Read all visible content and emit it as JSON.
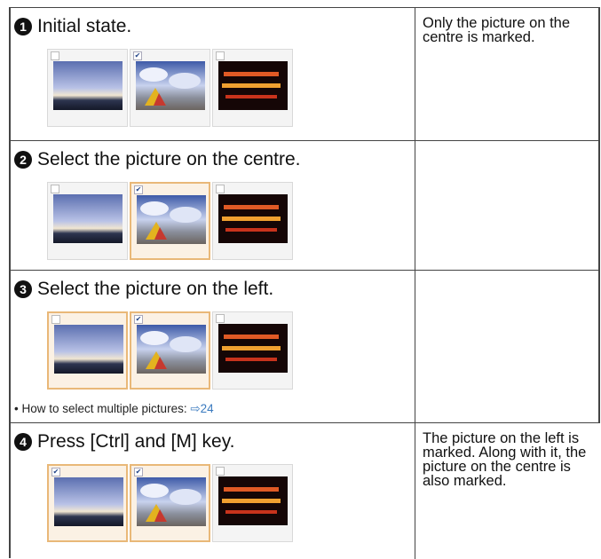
{
  "rows": [
    {
      "num": "1",
      "step": "Initial state.",
      "note": "Only the picture on the centre is marked.",
      "thumbs": [
        {
          "image": "sunset-sky",
          "checked": false,
          "selected": false
        },
        {
          "image": "clouds-tent",
          "checked": true,
          "selected": false
        },
        {
          "image": "night-lights",
          "checked": false,
          "selected": false
        }
      ]
    },
    {
      "num": "2",
      "step": "Select the picture on the centre.",
      "note": "",
      "thumbs": [
        {
          "image": "sunset-sky",
          "checked": false,
          "selected": false
        },
        {
          "image": "clouds-tent",
          "checked": true,
          "selected": true
        },
        {
          "image": "night-lights",
          "checked": false,
          "selected": false
        }
      ]
    },
    {
      "num": "3",
      "step": "Select the picture on the left.",
      "note": "",
      "tip_text": "How to select multiple pictures: ",
      "tip_link": "⇨24",
      "thumbs": [
        {
          "image": "sunset-sky",
          "checked": false,
          "selected": true
        },
        {
          "image": "clouds-tent",
          "checked": true,
          "selected": true
        },
        {
          "image": "night-lights",
          "checked": false,
          "selected": false
        }
      ]
    },
    {
      "num": "4",
      "step": "Press [Ctrl] and [M] key.",
      "note": "The picture on the left is marked. Along with it, the picture on the centre is also marked.",
      "thumbs": [
        {
          "image": "sunset-sky",
          "checked": true,
          "selected": true
        },
        {
          "image": "clouds-tent",
          "checked": true,
          "selected": true
        },
        {
          "image": "night-lights",
          "checked": false,
          "selected": false
        }
      ]
    }
  ],
  "check_glyph": "✔",
  "bullet": "•"
}
